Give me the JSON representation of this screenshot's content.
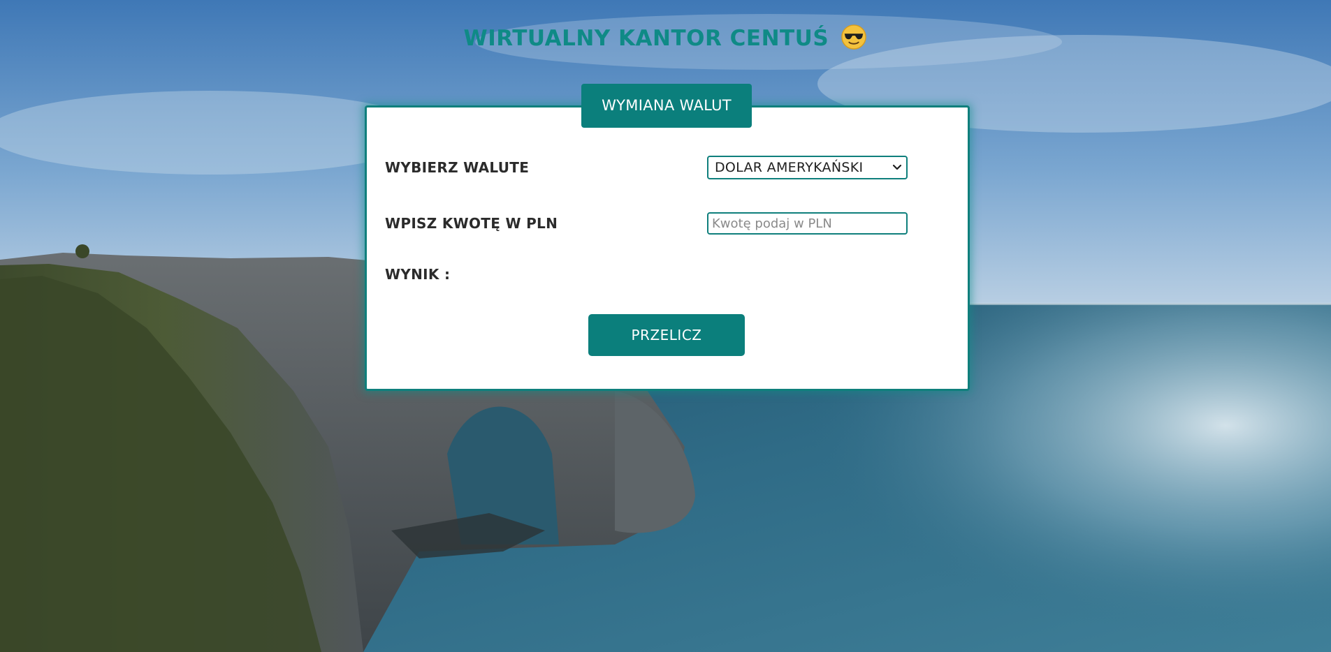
{
  "page": {
    "title": "WIRTUALNY KANTOR CENTUŚ",
    "title_emoji": "smiling-face-with-sunglasses-icon",
    "title_color": "#0f8a86",
    "background": "sea-cliff-arch-photo"
  },
  "panel": {
    "legend": "WYMIANA WALUT",
    "accent_color": "#0b7f7c"
  },
  "form": {
    "currency_label": "WYBIERZ WALUTE",
    "currency_selected": "DOLAR AMERYKAŃSKI",
    "amount_label": "WPISZ KWOTĘ W PLN",
    "amount_value": "",
    "amount_placeholder": "Kwotę podaj w PLN",
    "result_label": "WYNIK :",
    "result_value": "",
    "submit_label": "PRZELICZ"
  }
}
